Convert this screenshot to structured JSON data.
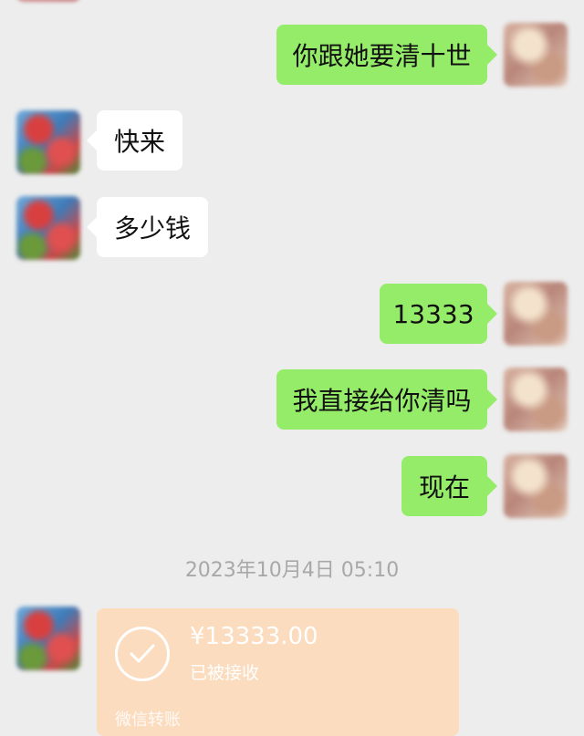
{
  "chat": {
    "messages": [
      {
        "side": "out",
        "text": "你跟她要清十世"
      },
      {
        "side": "in",
        "text": "快来"
      },
      {
        "side": "in",
        "text": "多少钱"
      },
      {
        "side": "out",
        "text": "13333"
      },
      {
        "side": "out",
        "text": "我直接给你清吗"
      },
      {
        "side": "out",
        "text": "现在"
      }
    ],
    "timestamp": "2023年10月4日 05:10",
    "transfer": {
      "amount": "¥13333.00",
      "status": "已被接收",
      "label": "微信转账"
    }
  },
  "colors": {
    "background": "#ededed",
    "outgoing_bubble": "#95ec69",
    "incoming_bubble": "#ffffff",
    "transfer_card": "#fbdcbf"
  },
  "icons": {
    "transfer_status": "check-circle-icon"
  }
}
